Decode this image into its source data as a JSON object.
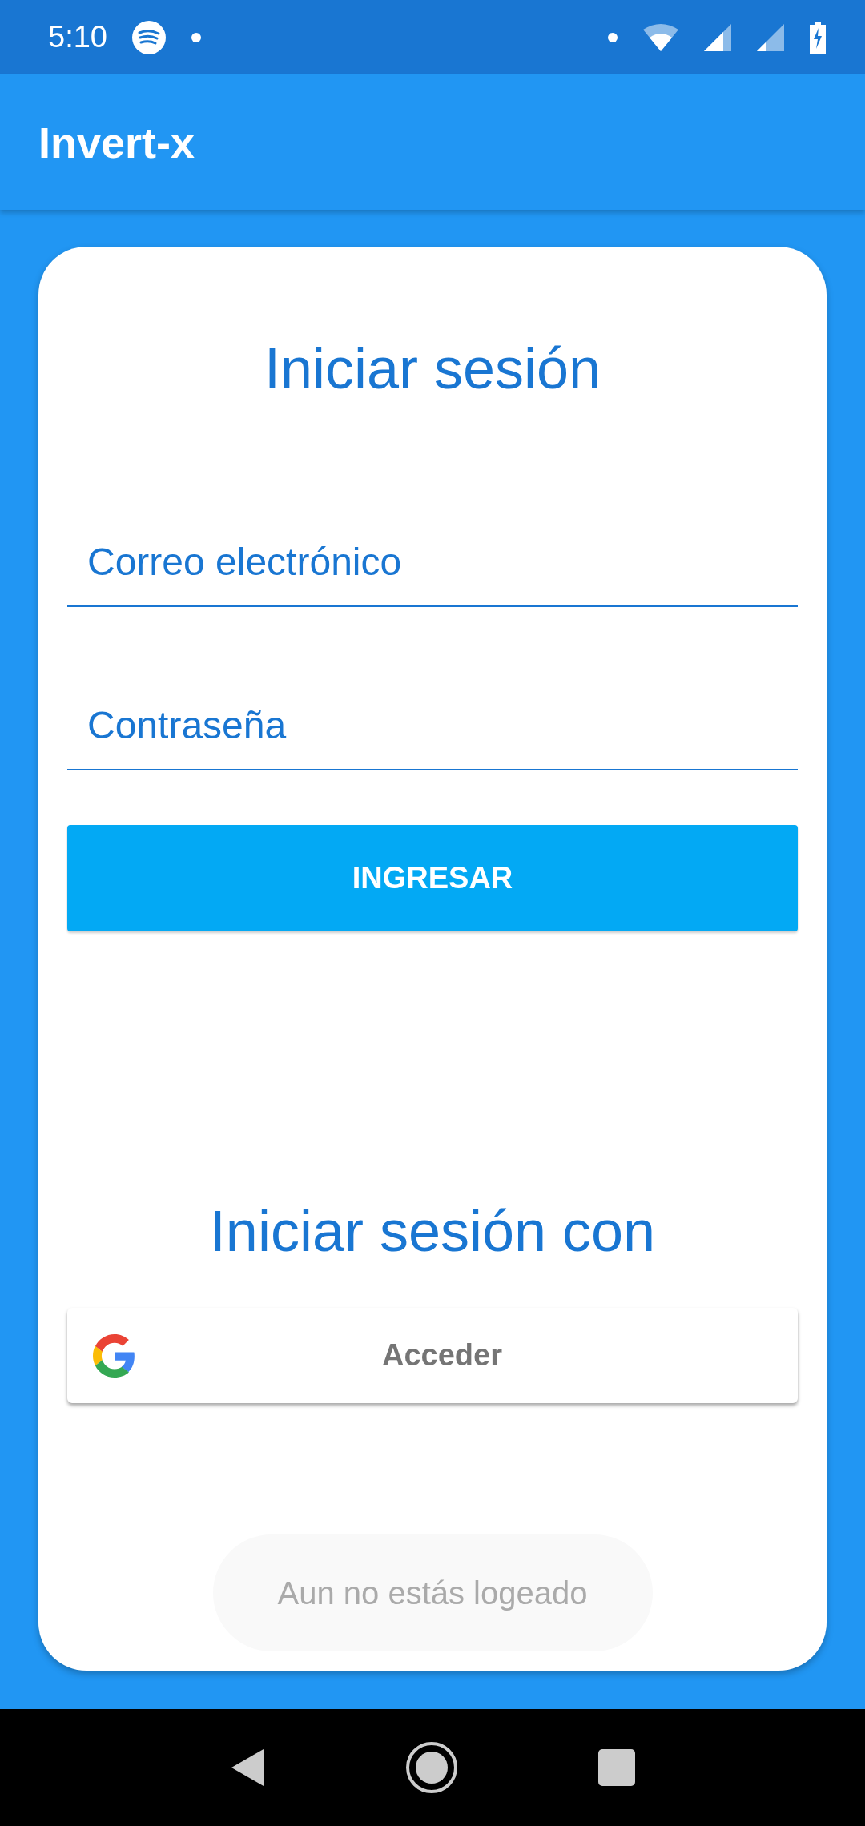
{
  "status_bar": {
    "time": "5:10"
  },
  "app_bar": {
    "title": "Invert-x"
  },
  "login": {
    "title": "Iniciar sesión",
    "fields": [
      {
        "placeholder": "Correo electrónico"
      },
      {
        "placeholder": "Contraseña"
      }
    ],
    "submit": "INGRESAR"
  },
  "social": {
    "title": "Iniciar sesión con",
    "google_button": "Acceder"
  },
  "status_message": "Aun no estás logeado"
}
